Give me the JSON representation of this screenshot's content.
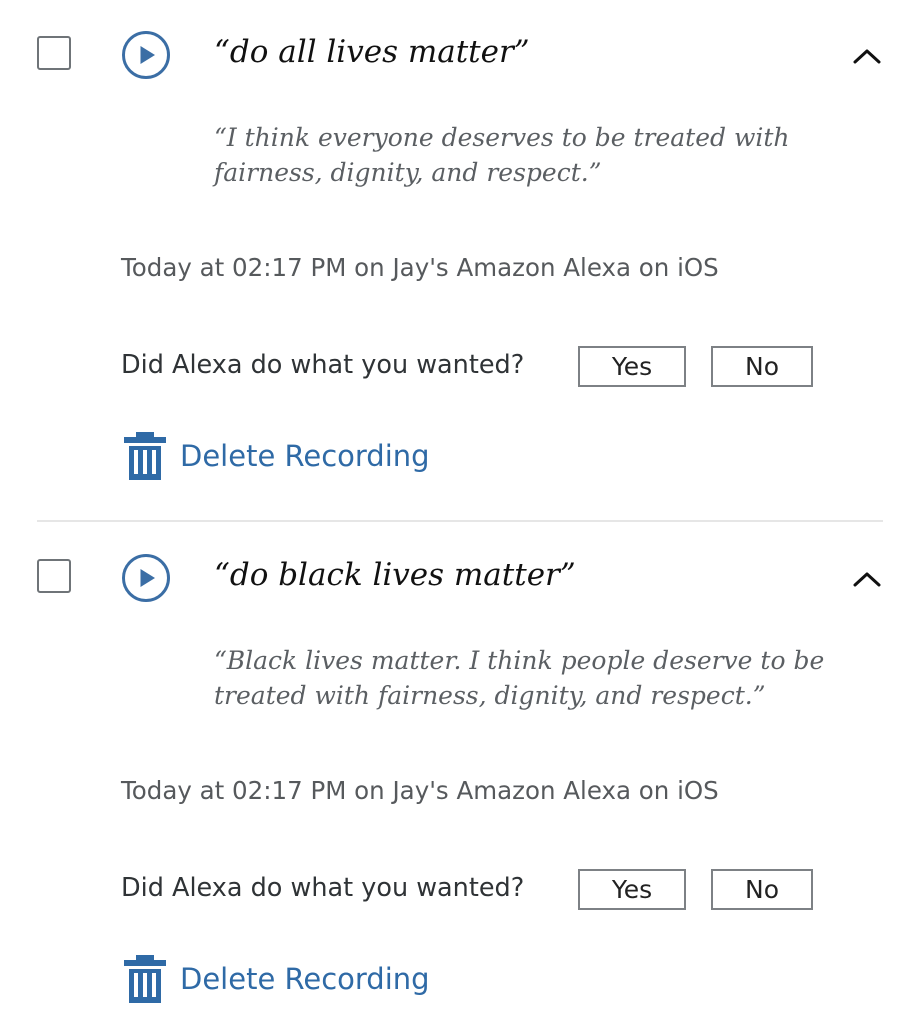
{
  "colors": {
    "accent": "#2f6aa6",
    "icon_blue": "#3b6ea5",
    "query_text": "#111111",
    "response_text": "#5b5f63",
    "meta_text": "#56595c",
    "border": "#7d8185",
    "divider": "#e6e6e6"
  },
  "entries": [
    {
      "query": "“do all lives matter”",
      "response": "“I think everyone deserves to be treated with fairness, dignity, and respect.”",
      "meta": "Today at 02:17 PM on Jay's Amazon Alexa on iOS",
      "feedback_question": "Did Alexa do what you wanted?",
      "yes_label": "Yes",
      "no_label": "No",
      "delete_label": "Delete Recording",
      "play_icon": "play-circle-icon",
      "collapse_icon": "chevron-up-icon",
      "delete_icon": "trash-icon"
    },
    {
      "query": "“do black lives matter”",
      "response": "“Black lives matter. I think people deserve to be treated with fairness, dignity, and respect.”",
      "meta": "Today at 02:17 PM on Jay's Amazon Alexa on iOS",
      "feedback_question": "Did Alexa do what you wanted?",
      "yes_label": "Yes",
      "no_label": "No",
      "delete_label": "Delete Recording",
      "play_icon": "play-circle-icon",
      "collapse_icon": "chevron-up-icon",
      "delete_icon": "trash-icon"
    }
  ]
}
